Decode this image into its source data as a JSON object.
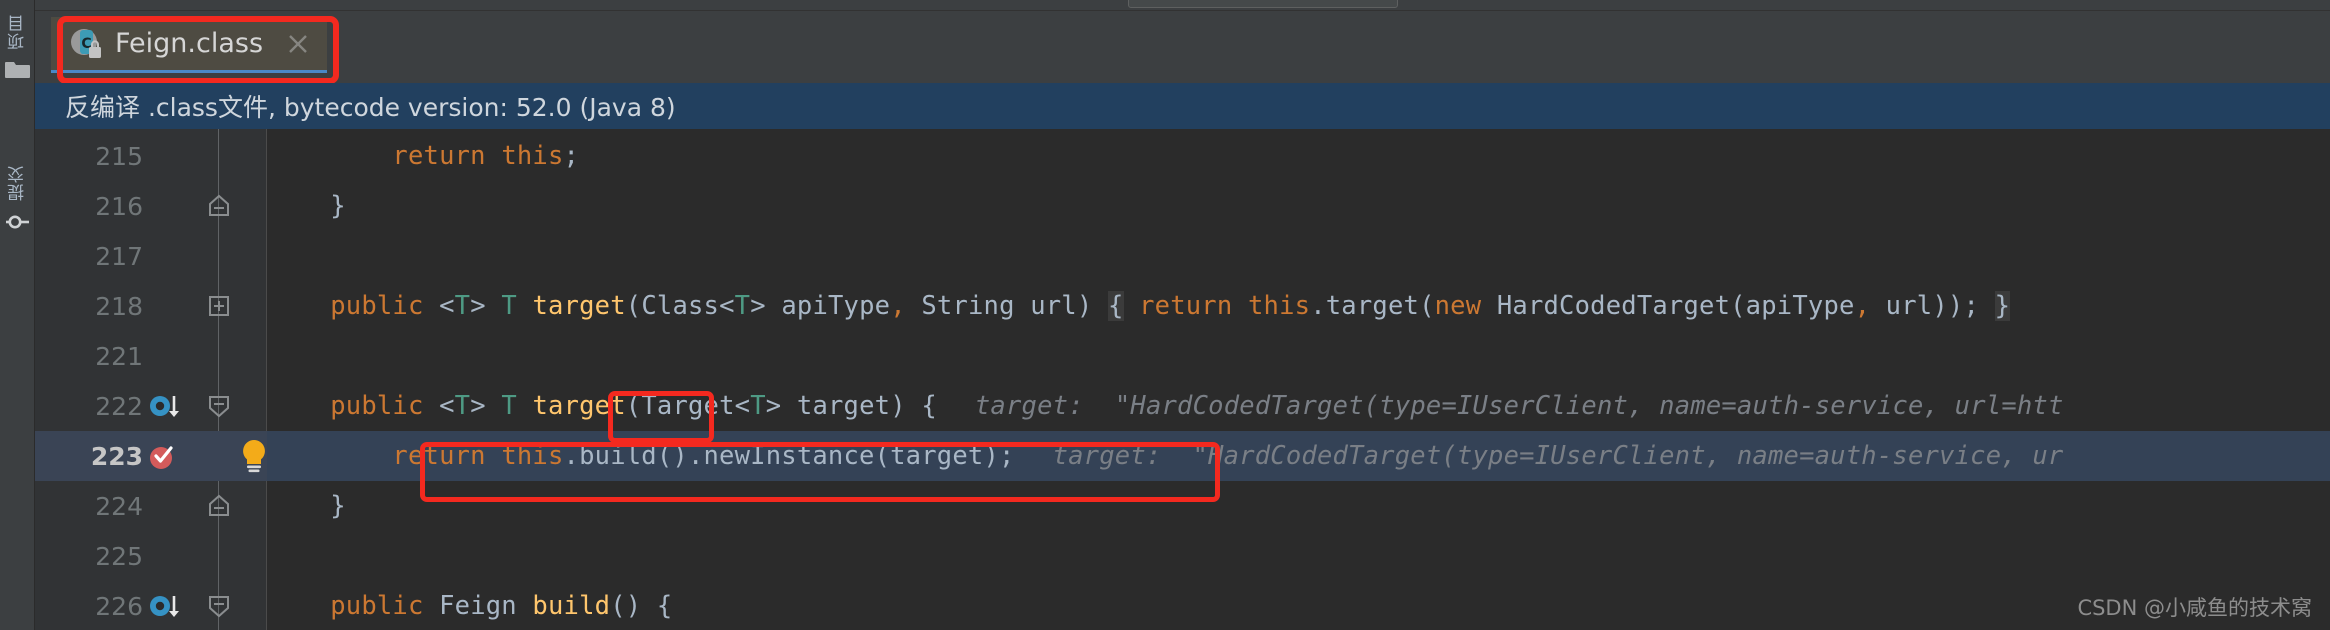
{
  "window": {
    "background": "#3c3f41",
    "editor_background": "#2b2b2b",
    "accent": "#4a88c7",
    "annotation_color": "#f4291f"
  },
  "toolwindow_strip": {
    "items": [
      {
        "label": "项目",
        "icon": "folder-icon"
      },
      {
        "label": "提交",
        "icon": "commit-icon"
      }
    ]
  },
  "search_field": {
    "value": "",
    "placeholder": ""
  },
  "tab": {
    "title": "Feign.class",
    "icon": "java-class-locked-icon",
    "close_icon": "close-icon",
    "active": true
  },
  "infobar": {
    "text": "反编译 .class文件, bytecode version: 52.0 (Java 8)"
  },
  "editor": {
    "lines": [
      {
        "number": "215",
        "indent": "        ",
        "tokens": [
          {
            "t": "return",
            "c": "kw"
          },
          {
            "t": " ",
            "c": "pln"
          },
          {
            "t": "this",
            "c": "kw"
          },
          {
            "t": ";",
            "c": "punc"
          }
        ],
        "marker": "",
        "fold": "",
        "current": false,
        "bulb": false
      },
      {
        "number": "216",
        "indent": "    ",
        "tokens": [
          {
            "t": "}",
            "c": "pln"
          }
        ],
        "marker": "",
        "fold": "collapse-end",
        "current": false,
        "bulb": false
      },
      {
        "number": "217",
        "indent": "",
        "tokens": [],
        "marker": "",
        "fold": "",
        "current": false,
        "bulb": false
      },
      {
        "number": "218",
        "indent": "    ",
        "tokens": [
          {
            "t": "public",
            "c": "kw"
          },
          {
            "t": " ",
            "c": "pln"
          },
          {
            "t": "<",
            "c": "punc"
          },
          {
            "t": "T",
            "c": "gen"
          },
          {
            "t": "> ",
            "c": "punc"
          },
          {
            "t": "T",
            "c": "gen"
          },
          {
            "t": " ",
            "c": "pln"
          },
          {
            "t": "target",
            "c": "fn"
          },
          {
            "t": "(Class<",
            "c": "pln"
          },
          {
            "t": "T",
            "c": "gen"
          },
          {
            "t": "> apiType",
            "c": "pln"
          },
          {
            "t": ",",
            "c": "kw"
          },
          {
            "t": " String url) ",
            "c": "pln"
          },
          {
            "t": "{",
            "c": "brace-hl"
          },
          {
            "t": " ",
            "c": "pln"
          },
          {
            "t": "return",
            "c": "kw"
          },
          {
            "t": " ",
            "c": "pln"
          },
          {
            "t": "this",
            "c": "kw"
          },
          {
            "t": ".target(",
            "c": "pln"
          },
          {
            "t": "new",
            "c": "kw"
          },
          {
            "t": " HardCodedTarget(apiType",
            "c": "pln"
          },
          {
            "t": ",",
            "c": "kw"
          },
          {
            "t": " url))",
            "c": "pln"
          },
          {
            "t": ";",
            "c": "punc"
          },
          {
            "t": " ",
            "c": "pln"
          },
          {
            "t": "}",
            "c": "brace-hl"
          }
        ],
        "marker": "",
        "fold": "expand",
        "current": false,
        "bulb": false
      },
      {
        "number": "221",
        "indent": "",
        "tokens": [],
        "marker": "",
        "fold": "",
        "current": false,
        "bulb": false
      },
      {
        "number": "222",
        "indent": "    ",
        "tokens": [
          {
            "t": "public",
            "c": "kw"
          },
          {
            "t": " ",
            "c": "pln"
          },
          {
            "t": "<",
            "c": "punc"
          },
          {
            "t": "T",
            "c": "gen"
          },
          {
            "t": "> ",
            "c": "punc"
          },
          {
            "t": "T",
            "c": "gen"
          },
          {
            "t": " ",
            "c": "pln"
          },
          {
            "t": "target",
            "c": "fn"
          },
          {
            "t": "(Target<",
            "c": "pln"
          },
          {
            "t": "T",
            "c": "gen"
          },
          {
            "t": "> target) ",
            "c": "pln"
          },
          {
            "t": "{",
            "c": "pln"
          }
        ],
        "hint": "target:  \"HardCodedTarget(type=IUserClient, name=auth-service, url=htt",
        "marker": "implemented-method-icon",
        "fold": "collapse-start",
        "current": false,
        "bulb": false
      },
      {
        "number": "223",
        "indent": "        ",
        "tokens": [
          {
            "t": "return",
            "c": "kw"
          },
          {
            "t": " ",
            "c": "pln"
          },
          {
            "t": "this",
            "c": "kw"
          },
          {
            "t": ".build().newInstance(target)",
            "c": "pln"
          },
          {
            "t": ";",
            "c": "punc"
          }
        ],
        "hint": "target:  \"HardCodedTarget(type=IUserClient, name=auth-service, ur",
        "marker": "breakpoint-verified-icon",
        "fold": "",
        "current": true,
        "bulb": true
      },
      {
        "number": "224",
        "indent": "    ",
        "tokens": [
          {
            "t": "}",
            "c": "pln"
          }
        ],
        "marker": "",
        "fold": "collapse-end",
        "current": false,
        "bulb": false
      },
      {
        "number": "225",
        "indent": "",
        "tokens": [],
        "marker": "",
        "fold": "",
        "current": false,
        "bulb": false
      },
      {
        "number": "226",
        "indent": "    ",
        "tokens": [
          {
            "t": "public",
            "c": "kw"
          },
          {
            "t": " Feign ",
            "c": "pln"
          },
          {
            "t": "build",
            "c": "fn"
          },
          {
            "t": "() {",
            "c": "pln"
          }
        ],
        "marker": "implemented-method-icon",
        "fold": "collapse-start",
        "current": false,
        "bulb": false
      }
    ]
  },
  "annotations": [
    {
      "name": "tab-highlight"
    },
    {
      "name": "target-method-name-highlight"
    },
    {
      "name": "return-statement-highlight"
    }
  ],
  "watermark": {
    "text": "CSDN @小咸鱼的技术窝"
  }
}
